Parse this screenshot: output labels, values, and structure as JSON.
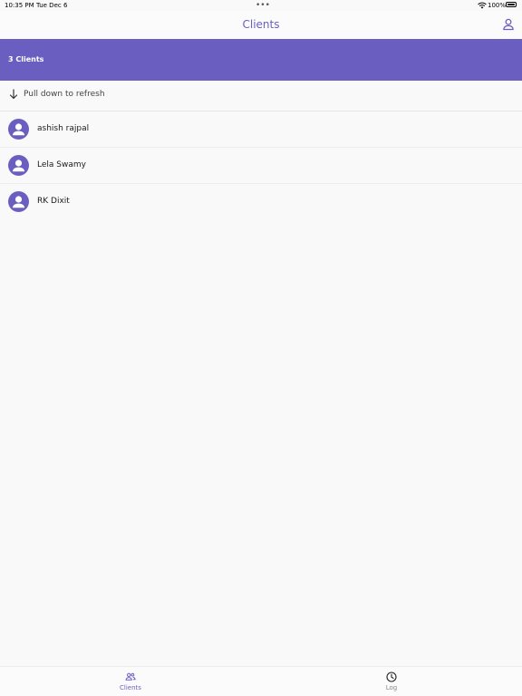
{
  "status_bar": {
    "time": "10:35 PM",
    "date": "Tue Dec 6",
    "battery_percent": "100%"
  },
  "nav": {
    "title": "Clients"
  },
  "banner": {
    "count_label": "3 Clients"
  },
  "refresh": {
    "text": "Pull down to refresh"
  },
  "clients": [
    {
      "name": "ashish rajpal"
    },
    {
      "name": "Lela Swamy"
    },
    {
      "name": "RK Dixit"
    }
  ],
  "tabs": [
    {
      "label": "Clients",
      "icon": "clients-icon",
      "selected": true
    },
    {
      "label": "Log",
      "icon": "clock-icon",
      "selected": false
    }
  ],
  "colors": {
    "accent": "#6a5fc1",
    "background": "#f9f9f9"
  }
}
